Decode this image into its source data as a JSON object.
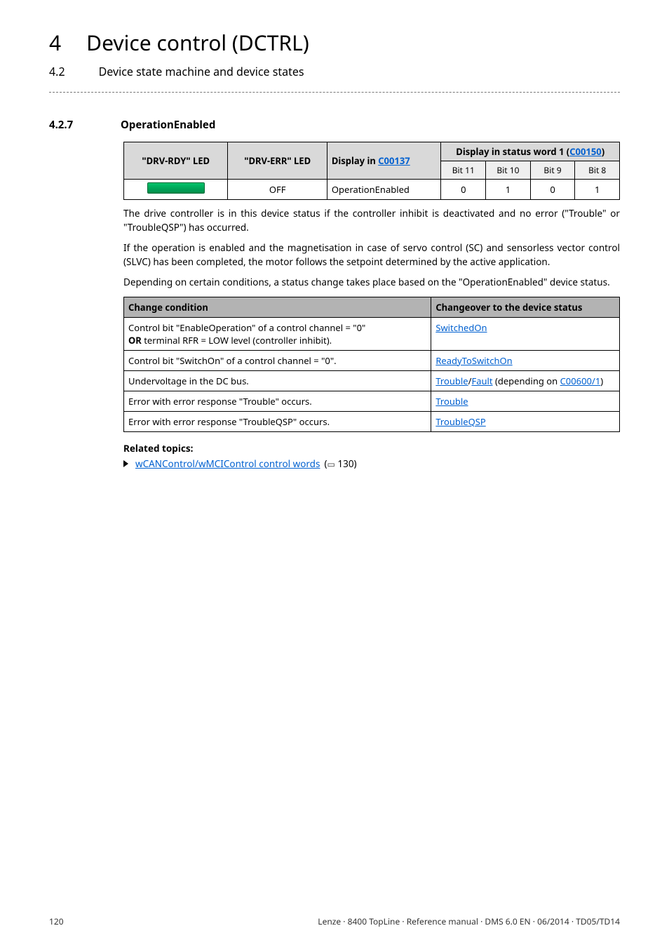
{
  "header": {
    "num_main": "4",
    "title_main": "Device control (DCTRL)",
    "num_sub": "4.2",
    "title_sub": "Device state machine and device states"
  },
  "subsection": {
    "number": "4.2.7",
    "title": "OperationEnabled"
  },
  "table1": {
    "headers": {
      "c1": "\"DRV-RDY\" LED",
      "c2": "\"DRV-ERR\" LED",
      "c3_prefix": "Display in ",
      "c3_link": "C00137",
      "c4_prefix": "Display in status word 1 (",
      "c4_link": "C00150",
      "c4_suffix": ")"
    },
    "sub_headers": [
      "Bit 11",
      "Bit 10",
      "Bit 9",
      "Bit 8"
    ],
    "row": {
      "drv_err": "OFF",
      "display": "OperationEnabled",
      "bits": [
        "0",
        "1",
        "0",
        "1"
      ]
    }
  },
  "paragraphs": {
    "p1": "The drive controller is in this device status if the controller inhibit is deactivated and no error (\"Trouble\" or \"TroubleQSP\") has occurred.",
    "p2": "If the operation is enabled and the magnetisation in case of servo control (SC) and sensorless vector control (SLVC) has been completed, the motor follows the setpoint determined by the active application.",
    "p3": "Depending on certain conditions, a status change takes place based on the \"OperationEnabled\" device status."
  },
  "table2": {
    "headers": {
      "c1": "Change condition",
      "c2": "Changeover to the device status"
    },
    "rows": [
      {
        "cond_line1": "Control bit \"EnableOperation\" of a control channel = \"0\"",
        "cond_line2_prefix": "OR",
        "cond_line2_rest": " terminal RFR = LOW level (controller inhibit).",
        "link": "SwitchedOn"
      },
      {
        "cond": "Control bit \"SwitchOn\" of a control channel = \"0\".",
        "link": "ReadyToSwitchOn"
      },
      {
        "cond": "Undervoltage in the DC bus.",
        "link1": "Trouble",
        "sep": "/",
        "link2": "Fault",
        "mid": " (depending on ",
        "link3": "C00600/1",
        "end": ")"
      },
      {
        "cond": "Error with error response \"Trouble\" occurs.",
        "link": "Trouble"
      },
      {
        "cond": "Error with error response \"TroubleQSP\" occurs.",
        "link": "TroubleQSP"
      }
    ]
  },
  "related": {
    "title": "Related topics:",
    "item_link": "wCANControl/wMCIControl control words",
    "item_page_prefix": " (",
    "item_page": " 130)",
    "book_glyph": "▭"
  },
  "footer": {
    "page": "120",
    "right": "Lenze · 8400 TopLine · Reference manual · DMS 6.0 EN · 06/2014 · TD05/TD14"
  }
}
